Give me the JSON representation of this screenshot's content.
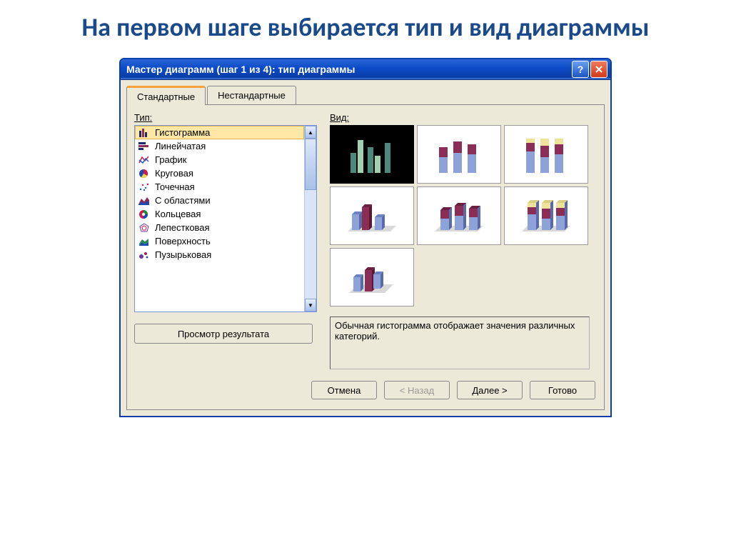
{
  "headline": "На первом шаге выбирается тип и вид диаграммы",
  "titlebar": "Мастер диаграмм (шаг 1 из 4): тип диаграммы",
  "tabs": {
    "standard": "Стандартные",
    "custom": "Нестандартные"
  },
  "labels": {
    "type": "Тип:",
    "subtype": "Вид:"
  },
  "chart_types": [
    {
      "id": "histogram",
      "label": "Гистограмма",
      "selected": true
    },
    {
      "id": "bar_h",
      "label": "Линейчатая"
    },
    {
      "id": "line",
      "label": "График"
    },
    {
      "id": "pie",
      "label": "Круговая"
    },
    {
      "id": "scatter",
      "label": "Точечная"
    },
    {
      "id": "area",
      "label": "С областями"
    },
    {
      "id": "doughnut",
      "label": "Кольцевая"
    },
    {
      "id": "radar",
      "label": "Лепестковая"
    },
    {
      "id": "surface",
      "label": "Поверхность"
    },
    {
      "id": "bubble",
      "label": "Пузырьковая"
    }
  ],
  "description": "Обычная гистограмма отображает значения различных категорий.",
  "buttons": {
    "preview": "Просмотр результата",
    "cancel": "Отмена",
    "back": "< Назад",
    "next": "Далее >",
    "finish": "Готово"
  },
  "colors": {
    "title_start": "#2a66d6",
    "title_end": "#0a3ea8",
    "accent": "#f7a23c",
    "selection": "#ffe8a6"
  }
}
